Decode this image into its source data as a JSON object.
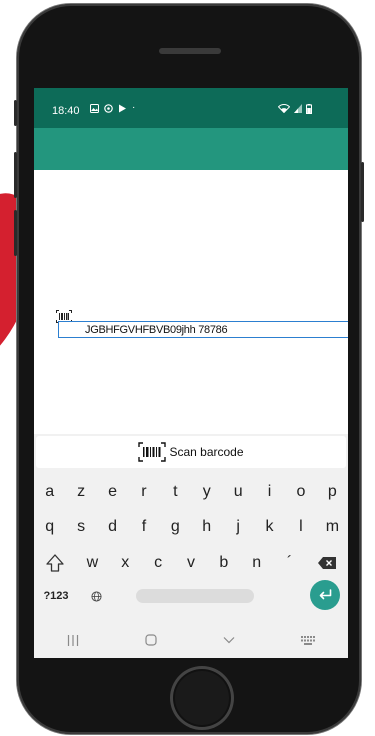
{
  "status": {
    "time": "18:40",
    "icons": [
      "image-icon",
      "whatsapp-icon",
      "play-store-icon",
      "dot-icon"
    ],
    "right_icons": [
      "wifi-icon",
      "signal-icon",
      "battery-icon"
    ]
  },
  "search": {
    "value": "JGBHFGVHFBVB09jhh 78786"
  },
  "keyboard": {
    "scan_label": "Scan barcode",
    "row1": [
      "a",
      "z",
      "e",
      "r",
      "t",
      "y",
      "u",
      "i",
      "o",
      "p"
    ],
    "row2": [
      "q",
      "s",
      "d",
      "f",
      "g",
      "h",
      "j",
      "k",
      "l",
      "m"
    ],
    "row3": [
      "w",
      "x",
      "c",
      "v",
      "b",
      "n",
      "´"
    ],
    "mode_key": "?123"
  },
  "colors": {
    "statusbar": "#0d6b58",
    "appbar": "#23967e",
    "search_accent": "#2c7fd0",
    "enter_key": "#2a9d8f"
  }
}
